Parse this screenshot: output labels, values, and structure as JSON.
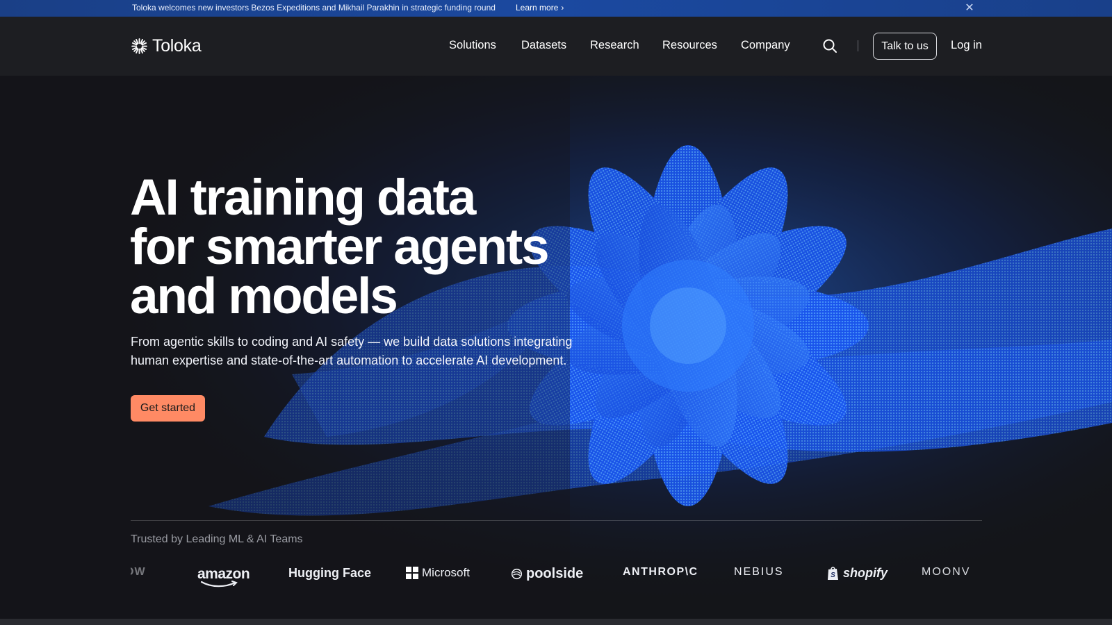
{
  "announcement": {
    "text": "Toloka welcomes new investors Bezos Expeditions and Mikhail Parakhin in strategic funding round",
    "link_label": "Learn more",
    "close_icon": "close-icon"
  },
  "nav": {
    "brand": "Toloka",
    "links": [
      "Solutions",
      "Datasets",
      "Research",
      "Resources",
      "Company"
    ],
    "search_icon": "search-icon",
    "talk_label": "Talk to us",
    "login_label": "Log in"
  },
  "hero": {
    "title_lines": [
      "AI training data",
      "for smarter agents",
      "and models"
    ],
    "subtitle_lines": [
      "From agentic skills to coding and AI safety — we build data solutions integrating",
      "human expertise and state-of-the-art automation to accelerate AI development."
    ],
    "cta_label": "Get started"
  },
  "trusted": {
    "label": "Trusted by Leading ML & AI Teams",
    "logos": [
      "OW",
      "amazon",
      "Hugging Face",
      "Microsoft",
      "poolside",
      "ANTHROP\\C",
      "NEBIUS",
      "shopify",
      "MOONV"
    ]
  },
  "colors": {
    "announce_bg": "#1b49a0",
    "nav_bg": "#1d1e22",
    "hero_bg": "#141519",
    "cta_bg": "#ff8a64",
    "art_blue": "#1a5cff"
  }
}
